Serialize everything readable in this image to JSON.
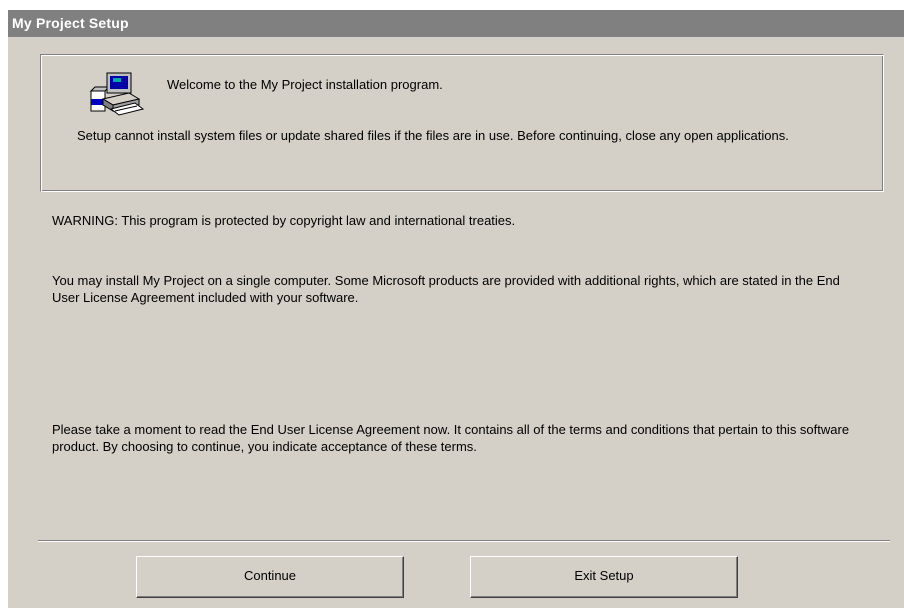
{
  "window": {
    "title": "My Project Setup"
  },
  "welcome_panel": {
    "icon": "setup-computer-icon",
    "heading": "Welcome to the My Project installation program.",
    "note": "Setup cannot install system files or update shared files if the files are in use. Before continuing, close any open applications."
  },
  "body": {
    "warning": "WARNING: This program is protected by copyright law and international treaties.",
    "license": "You may install My Project on a single computer. Some Microsoft products are provided with additional rights, which are stated in the End User License Agreement included with your software.",
    "eula": "Please take a moment to read the End User License Agreement now. It contains all of the terms and conditions that pertain to this software product. By choosing to continue, you indicate acceptance of these terms."
  },
  "buttons": {
    "continue": "Continue",
    "exit": "Exit Setup"
  },
  "colors": {
    "dialog_face": "#d4d0c8",
    "title_bar": "#808080",
    "title_text": "#ffffff"
  }
}
